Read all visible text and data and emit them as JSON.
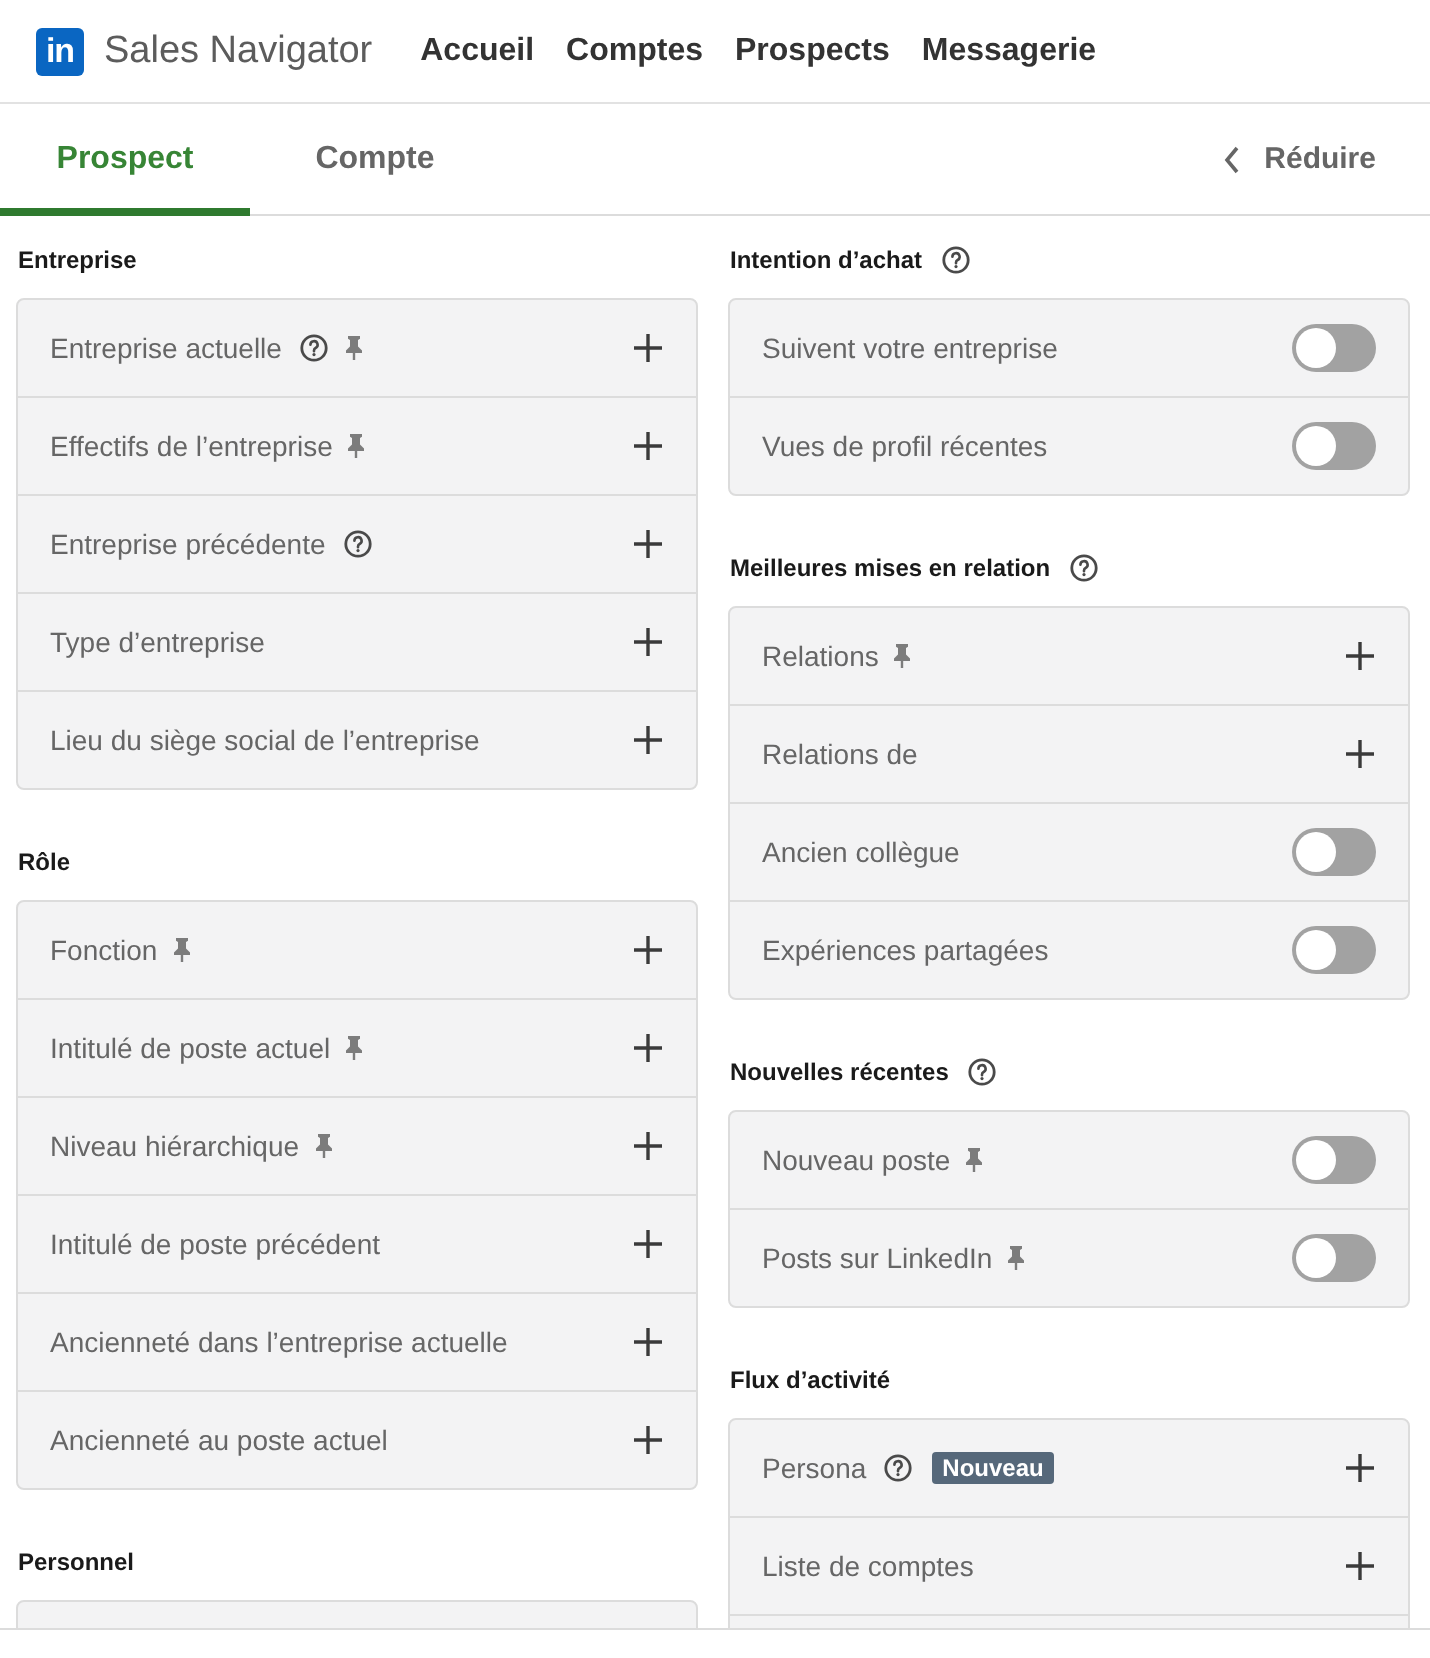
{
  "header": {
    "logo": {
      "mark": "in",
      "name": "Sales Navigator"
    },
    "nav": [
      {
        "label": "Accueil"
      },
      {
        "label": "Comptes"
      },
      {
        "label": "Prospects"
      },
      {
        "label": "Messagerie"
      }
    ]
  },
  "tabs": [
    {
      "label": "Prospect",
      "selected": true
    },
    {
      "label": "Compte",
      "selected": false
    }
  ],
  "collapse": {
    "label": "Réduire"
  },
  "columns": [
    {
      "sections": [
        {
          "title": "Entreprise",
          "help": false,
          "cut": false,
          "items": [
            {
              "label": "Entreprise actuelle",
              "help": true,
              "pinned": true,
              "kind": "add"
            },
            {
              "label": "Effectifs de l’entreprise",
              "help": false,
              "pinned": true,
              "kind": "add"
            },
            {
              "label": "Entreprise précédente",
              "help": true,
              "pinned": false,
              "kind": "add"
            },
            {
              "label": "Type d’entreprise",
              "help": false,
              "pinned": false,
              "kind": "add"
            },
            {
              "label": "Lieu du siège social de l’entreprise",
              "help": false,
              "pinned": false,
              "kind": "add"
            }
          ]
        },
        {
          "title": "Rôle",
          "help": false,
          "cut": false,
          "items": [
            {
              "label": "Fonction",
              "help": false,
              "pinned": true,
              "kind": "add"
            },
            {
              "label": "Intitulé de poste actuel",
              "help": false,
              "pinned": true,
              "kind": "add"
            },
            {
              "label": "Niveau hiérarchique",
              "help": false,
              "pinned": true,
              "kind": "add"
            },
            {
              "label": "Intitulé de poste précédent",
              "help": false,
              "pinned": false,
              "kind": "add"
            },
            {
              "label": "Ancienneté dans l’entreprise actuelle",
              "help": false,
              "pinned": false,
              "kind": "add"
            },
            {
              "label": "Ancienneté au poste actuel",
              "help": false,
              "pinned": false,
              "kind": "add"
            }
          ]
        },
        {
          "title": "Personnel",
          "help": false,
          "cut": true
        }
      ]
    },
    {
      "sections": [
        {
          "title": "Intention d’achat",
          "help": true,
          "cut": false,
          "items": [
            {
              "label": "Suivent votre entreprise",
              "help": false,
              "pinned": false,
              "kind": "toggle",
              "on": false
            },
            {
              "label": "Vues de profil récentes",
              "help": false,
              "pinned": false,
              "kind": "toggle",
              "on": false
            }
          ]
        },
        {
          "title": "Meilleures mises en relation",
          "help": true,
          "cut": false,
          "items": [
            {
              "label": "Relations",
              "help": false,
              "pinned": true,
              "kind": "add"
            },
            {
              "label": "Relations de",
              "help": false,
              "pinned": false,
              "kind": "add"
            },
            {
              "label": "Ancien collègue",
              "help": false,
              "pinned": false,
              "kind": "toggle",
              "on": false
            },
            {
              "label": "Expériences partagées",
              "help": false,
              "pinned": false,
              "kind": "toggle",
              "on": false
            }
          ]
        },
        {
          "title": "Nouvelles récentes",
          "help": true,
          "cut": false,
          "items": [
            {
              "label": "Nouveau poste",
              "help": false,
              "pinned": true,
              "kind": "toggle",
              "on": false
            },
            {
              "label": "Posts sur LinkedIn",
              "help": false,
              "pinned": true,
              "kind": "toggle",
              "on": false
            }
          ]
        },
        {
          "title": "Flux d’activité",
          "help": false,
          "cut": true,
          "items": [
            {
              "label": "Persona",
              "help": true,
              "pinned": false,
              "badge": "Nouveau",
              "kind": "add"
            },
            {
              "label": "Liste de comptes",
              "help": false,
              "pinned": false,
              "kind": "add"
            }
          ]
        }
      ]
    }
  ]
}
